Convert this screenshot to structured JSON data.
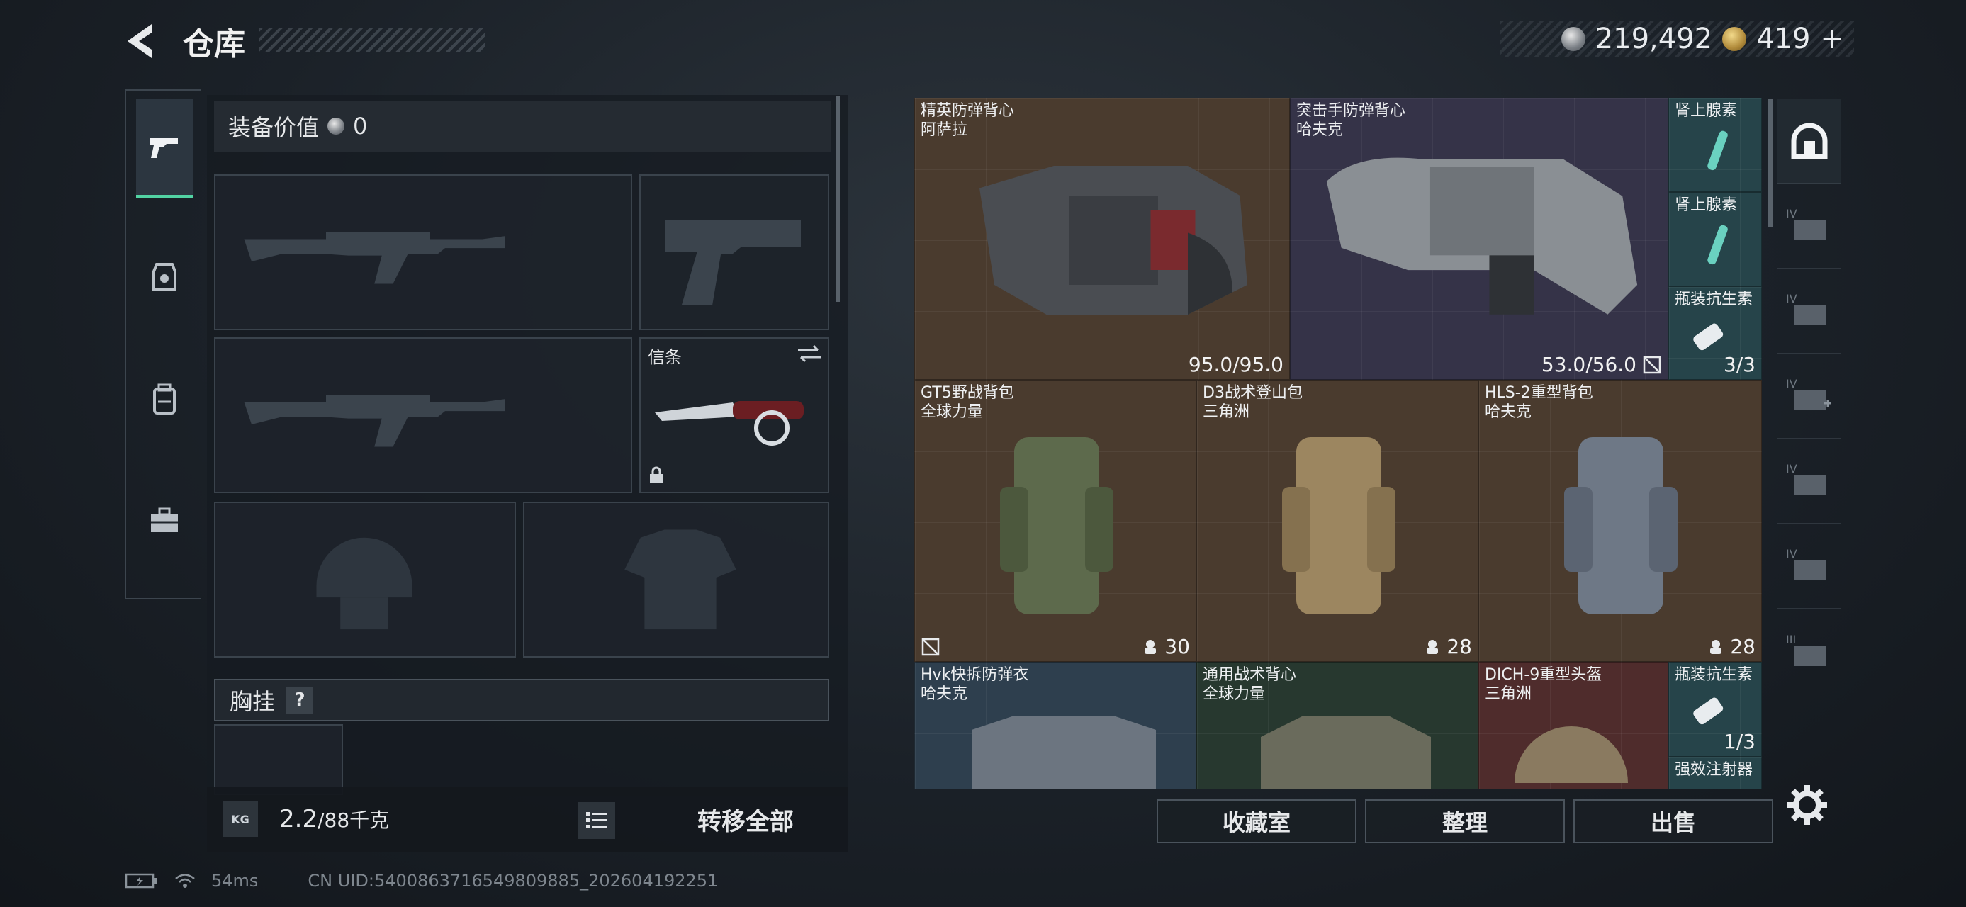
{
  "header": {
    "title": "仓库",
    "silver_amount": "219,492",
    "gold_amount": "419",
    "gold_plus": "+"
  },
  "categories": [
    "pistol-icon",
    "armor-icon",
    "backpack-icon",
    "toolbox-icon"
  ],
  "loadout": {
    "equip_value_label": "装备价值",
    "equip_value": "0",
    "knife_label": "信条",
    "chest_label": "胸挂",
    "chest_help": "?",
    "weight_value": "2.2",
    "weight_max": "/88千克",
    "kg_label": "KG",
    "transfer_all": "转移全部"
  },
  "storage": {
    "items": [
      {
        "name": "精英防弹背心",
        "sub": "阿萨拉",
        "value": "95.0/95.0"
      },
      {
        "name": "突击手防弹背心",
        "sub": "哈夫克",
        "value": "53.0/56.0"
      },
      {
        "name": "肾上腺素",
        "sub": "",
        "value": ""
      },
      {
        "name": "肾上腺素",
        "sub": "",
        "value": ""
      },
      {
        "name": "瓶装抗生素",
        "sub": "",
        "value": "3/3"
      },
      {
        "name": "GT5野战背包",
        "sub": "全球力量",
        "value": "30"
      },
      {
        "name": "D3战术登山包",
        "sub": "三角洲",
        "value": "28"
      },
      {
        "name": "HLS-2重型背包",
        "sub": "哈夫克",
        "value": "28"
      },
      {
        "name": "Hvk快拆防弹衣",
        "sub": "哈夫克",
        "value": ""
      },
      {
        "name": "通用战术背心",
        "sub": "全球力量",
        "value": ""
      },
      {
        "name": "DICH-9重型头盔",
        "sub": "三角洲",
        "value": ""
      },
      {
        "name": "瓶装抗生素",
        "sub": "",
        "value": "1/3"
      },
      {
        "name": "强效注射器",
        "sub": "",
        "value": ""
      }
    ]
  },
  "buttons": {
    "collection": "收藏室",
    "sort": "整理",
    "sell": "出售"
  },
  "filters": [
    "all-icon",
    "IV",
    "IV",
    "IV",
    "IV",
    "IV",
    "III"
  ],
  "status": {
    "ping": "54ms",
    "uid": "CN UID:5400863716549809885_202604192251"
  }
}
